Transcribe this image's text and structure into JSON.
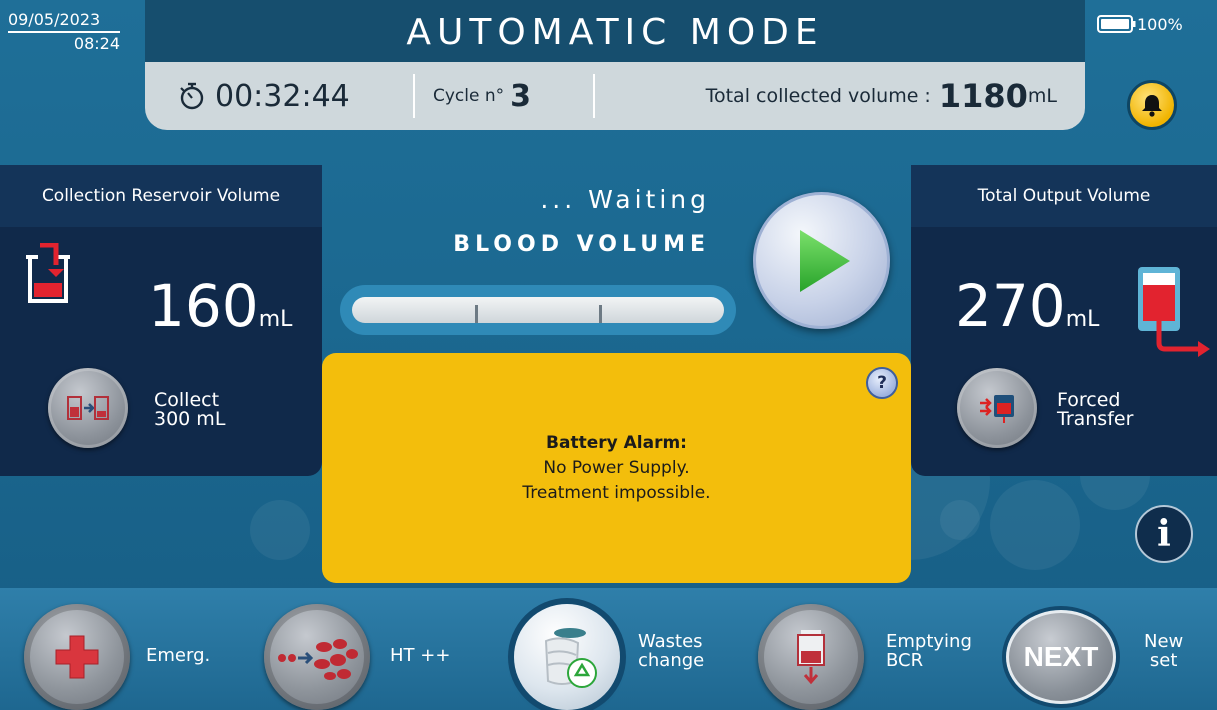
{
  "header": {
    "date": "09/05/2023",
    "time": "08:24",
    "title": "AUTOMATIC MODE",
    "battery_level": "100%",
    "timer": "00:32:44",
    "cycle_label": "Cycle n°",
    "cycle_value": "3",
    "total_label": "Total collected volume :",
    "total_value": "1180",
    "total_unit": "mL"
  },
  "left_panel": {
    "title": "Collection Reservoir Volume",
    "volume": "160",
    "unit": "mL",
    "button_label_line1": "Collect",
    "button_label_line2": "300 mL",
    "icon": "reservoir-icon",
    "button_icon": "collect-transfer-icon"
  },
  "center": {
    "status": "... Waiting",
    "label": "BLOOD VOLUME",
    "progress_fraction": 0.0,
    "play_icon": "play-icon"
  },
  "alarm": {
    "title": "Battery Alarm:",
    "line1": "No Power Supply.",
    "line2": "Treatment impossible.",
    "help_symbol": "?"
  },
  "right_panel": {
    "title": "Total Output Volume",
    "volume": "270",
    "unit": "mL",
    "button_label_line1": "Forced",
    "button_label_line2": "Transfer",
    "icon": "output-bag-icon",
    "button_icon": "forced-transfer-icon"
  },
  "info_symbol": "i",
  "bottom": {
    "emerg_label": "Emerg.",
    "ht_label": "HT ++",
    "wastes_line1": "Wastes",
    "wastes_line2": "change",
    "emptying_line1": "Emptying",
    "emptying_line2": "BCR",
    "next_label": "NEXT",
    "new_line1": "New",
    "new_line2": "set"
  },
  "colors": {
    "background": "#1b6890",
    "alarm": "#f3be0c",
    "panel": "#10294a",
    "accent_red": "#e2232f",
    "play_green": "#3bc33b",
    "bell": "#f1b400"
  }
}
